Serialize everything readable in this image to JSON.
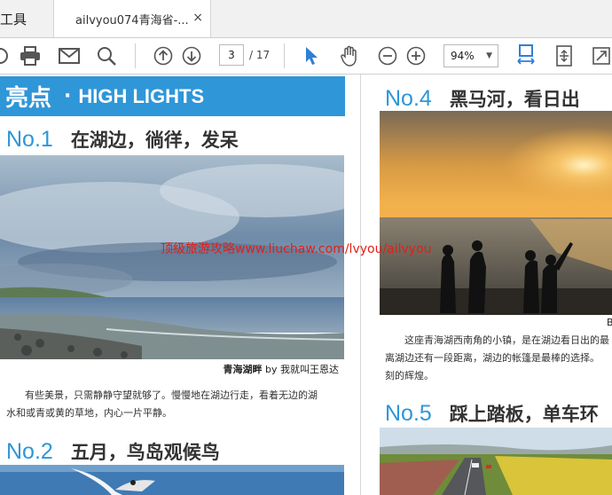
{
  "tabs": {
    "tools_label": "工具",
    "document_title": "ailvyou074青海省-...",
    "close_glyph": "×"
  },
  "toolbar": {
    "current_page": "3",
    "total_pages": "/ 17",
    "zoom": "94%",
    "zoom_arrow": "▼"
  },
  "page_left": {
    "banner_cn": "亮点",
    "banner_dot": "·",
    "banner_en": "HIGH LIGHTS",
    "sec1_no": "No.1",
    "sec1_title": "在湖边，徜徉，发呆",
    "photo1_caption_bold": "青海湖畔",
    "photo1_caption_rest": " by 我就叫王恩达",
    "sec1_para_line1": "有些美景，只需静静守望就够了。慢慢地在湖边行走，看着无边的湖",
    "sec1_para_line2": "水和或青或黄的草地，内心一片平静。",
    "sec2_no": "No.2",
    "sec2_title": "五月，鸟岛观候鸟"
  },
  "page_right": {
    "sec4_no": "No.4",
    "sec4_title": "黑马河，看日出",
    "photo4_caption": "B",
    "sec4_para_line1": "这座青海湖西南角的小镇，是在湖边看日出的最",
    "sec4_para_line2": "离湖边还有一段距离，湖边的帐篷是最棒的选择。",
    "sec4_para_line3": "刻的辉煌。",
    "sec5_no": "No.5",
    "sec5_title": "踩上踏板，单车环"
  },
  "watermark": "顶级旅游攻略www.liuchaw.com/lvyou/ailvyou",
  "colors": {
    "accent": "#2f96d8",
    "watermark": "#e0201a",
    "toolbar_icon": "#555555",
    "select_tool": "#2f7fd6"
  },
  "icons": [
    "mail-icon",
    "print-icon",
    "email-icon",
    "search-icon",
    "arrow-up-circle-icon",
    "arrow-down-circle-icon",
    "select-cursor-icon",
    "hand-icon",
    "zoom-out-icon",
    "zoom-in-icon",
    "fit-width-icon",
    "fit-page-icon",
    "fullscreen-icon"
  ]
}
